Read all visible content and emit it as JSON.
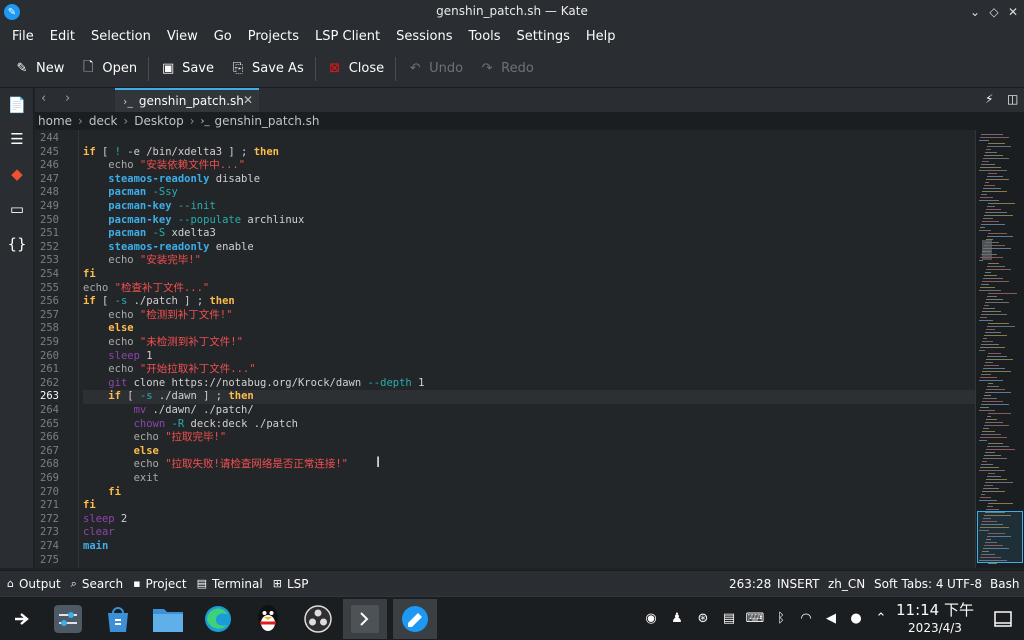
{
  "window": {
    "title": "genshin_patch.sh — Kate"
  },
  "menu": [
    "File",
    "Edit",
    "Selection",
    "View",
    "Go",
    "Projects",
    "LSP Client",
    "Sessions",
    "Tools",
    "Settings",
    "Help"
  ],
  "toolbar": {
    "new": "New",
    "open": "Open",
    "save": "Save",
    "save_as": "Save As",
    "close": "Close",
    "undo": "Undo",
    "redo": "Redo"
  },
  "tab": {
    "label": "genshin_patch.sh"
  },
  "breadcrumb": [
    "home",
    "deck",
    "Desktop",
    "genshin_patch.sh"
  ],
  "editor": {
    "current_line": 263,
    "lines": [
      {
        "n": "244",
        "html": ""
      },
      {
        "n": "245",
        "html": "<span class='kw'>if</span> [ <span class='opt'>!</span> -e /bin/xdelta3 ] ; <span class='kw'>then</span>"
      },
      {
        "n": "246",
        "html": "    <span class='pl'>echo</span> <span class='str'>\"安装依赖文件中...\"</span>"
      },
      {
        "n": "247",
        "html": "    <span class='fn'>steamos-readonly</span> disable"
      },
      {
        "n": "248",
        "html": "    <span class='fn'>pacman</span> <span class='opt'>-Ssy</span>"
      },
      {
        "n": "249",
        "html": "    <span class='fn'>pacman-key</span> <span class='opt'>--init</span>"
      },
      {
        "n": "250",
        "html": "    <span class='fn'>pacman-key</span> <span class='opt'>--populate</span> archlinux"
      },
      {
        "n": "251",
        "html": "    <span class='fn'>pacman</span> <span class='opt'>-S</span> xdelta3"
      },
      {
        "n": "252",
        "html": "    <span class='fn'>steamos-readonly</span> enable"
      },
      {
        "n": "253",
        "html": "    <span class='pl'>echo</span> <span class='str'>\"安装完毕!\"</span>"
      },
      {
        "n": "254",
        "html": "<span class='kw'>fi</span>"
      },
      {
        "n": "255",
        "html": "<span class='pl'>echo</span> <span class='str'>\"检查补丁文件...\"</span>"
      },
      {
        "n": "256",
        "html": "<span class='kw'>if</span> [ <span class='opt'>-s</span> ./patch ] ; <span class='kw'>then</span>"
      },
      {
        "n": "257",
        "html": "    <span class='pl'>echo</span> <span class='str'>\"检测到补丁文件!\"</span>"
      },
      {
        "n": "258",
        "html": "    <span class='kw'>else</span>"
      },
      {
        "n": "259",
        "html": "    <span class='pl'>echo</span> <span class='str'>\"未检测到补丁文件!\"</span>"
      },
      {
        "n": "260",
        "html": "    <span class='cmd'>sleep</span> 1"
      },
      {
        "n": "261",
        "html": "    <span class='pl'>echo</span> <span class='str'>\"开始拉取补丁文件...\"</span>"
      },
      {
        "n": "262",
        "html": "    <span class='cmd'>git</span> clone https://notabug.org/Krock/dawn <span class='opt'>--depth</span> 1"
      },
      {
        "n": "263",
        "html": "    <span class='kw'>if</span> [ <span class='opt'>-s</span> ./dawn ] ; <span class='kw'>then</span>"
      },
      {
        "n": "264",
        "html": "        <span class='cmd'>mv</span> ./dawn/ ./patch/"
      },
      {
        "n": "265",
        "html": "        <span class='cmd'>chown</span> <span class='opt'>-R</span> deck:deck ./patch"
      },
      {
        "n": "266",
        "html": "        <span class='pl'>echo</span> <span class='str'>\"拉取完毕!\"</span>"
      },
      {
        "n": "267",
        "html": "        <span class='kw'>else</span>"
      },
      {
        "n": "268",
        "html": "        <span class='pl'>echo</span> <span class='str'>\"拉取失败!请检查网络是否正常连接!\"</span>"
      },
      {
        "n": "269",
        "html": "        <span class='pl'>exit</span>"
      },
      {
        "n": "270",
        "html": "    <span class='kw'>fi</span>"
      },
      {
        "n": "271",
        "html": "<span class='kw'>fi</span>"
      },
      {
        "n": "272",
        "html": "<span class='cmd'>sleep</span> 2"
      },
      {
        "n": "273",
        "html": "<span class='cmd'>clear</span>"
      },
      {
        "n": "274",
        "html": "<span class='fn'>main</span>"
      },
      {
        "n": "275",
        "html": ""
      }
    ]
  },
  "statusbar": {
    "output": "Output",
    "search": "Search",
    "project": "Project",
    "terminal": "Terminal",
    "lsp": "LSP",
    "cursor_pos": "263:28",
    "mode": "INSERT",
    "locale": "zh_CN",
    "tabs": "Soft Tabs: 4",
    "encoding": "UTF-8",
    "language": "Bash"
  },
  "taskbar": {
    "time": "11:14 下午",
    "date": "2023/4/3"
  },
  "colors": {
    "accent": "#3daee9",
    "keyword": "#fdbc4b",
    "string": "#f44f4f",
    "function": "#3daee9",
    "command": "#8e44ad",
    "close_icon": "#ed1515"
  }
}
